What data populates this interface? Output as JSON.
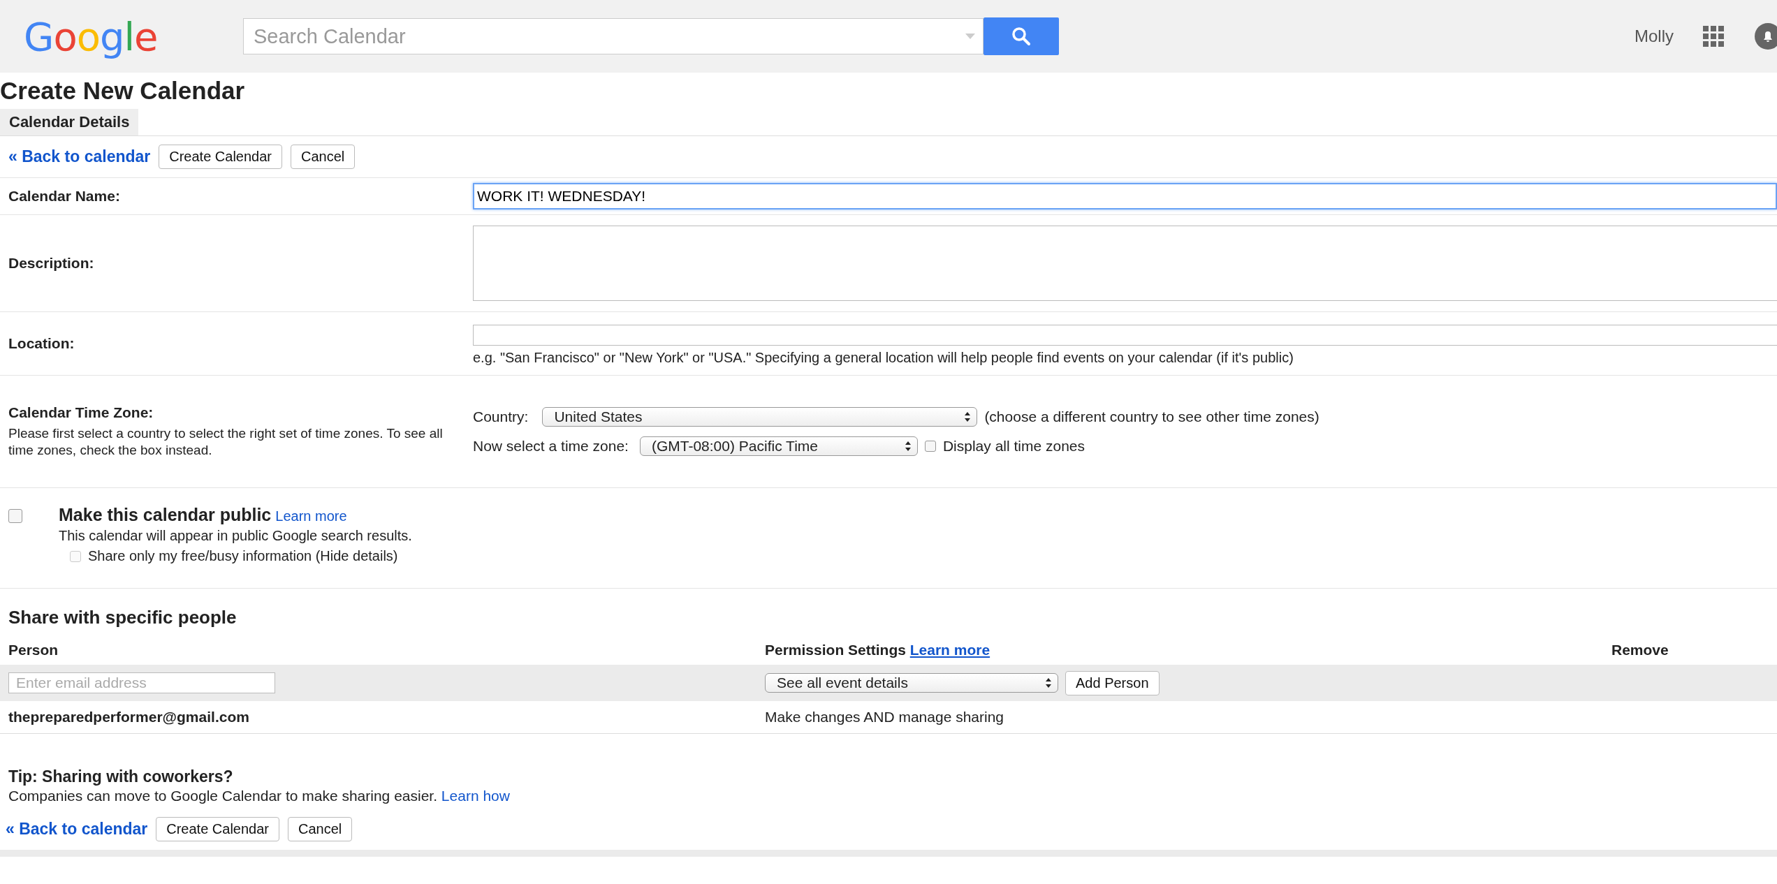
{
  "header": {
    "logo": "Google",
    "search": {
      "placeholder": "Search Calendar"
    },
    "user": "Molly"
  },
  "page_title": "Create New Calendar",
  "tabs": [
    {
      "label": "Calendar Details",
      "selected": true
    }
  ],
  "top_actions": {
    "back": "« Back to calendar",
    "buttons": [
      "Create Calendar",
      "Cancel"
    ]
  },
  "form": {
    "name": {
      "label": "Calendar Name:",
      "value": "WORK IT! WEDNESDAY!",
      "focused": true
    },
    "description": {
      "label": "Description:"
    },
    "location": {
      "label": "Location:",
      "hint": "e.g. \"San Francisco\" or \"New York\" or \"USA.\" Specifying a general location will help people find events on your calendar (if it's public)"
    },
    "time_zone": {
      "label": "Calendar Time Zone:",
      "help": "Please first select a country to select the right set of time zones. To see all time zones, check the box instead.",
      "country_label": "Country:",
      "country": "United States",
      "country_note": "(choose a different country to see other time zones)",
      "zone_label": "Now select a time zone:",
      "zone": "(GMT-08:00) Pacific Time",
      "display_all": {
        "label": "Display all time zones",
        "checked": false
      }
    },
    "public": {
      "label": "Make this calendar public",
      "checked": false,
      "link": "Learn more",
      "note": "This calendar will appear in public Google search results.",
      "free_busy": {
        "label": "Share only my free/busy information (Hide details)",
        "checked": false,
        "disabled": true
      }
    }
  },
  "sharing": {
    "title": "Share with specific people",
    "columns": [
      "Person",
      "Permission Settings",
      "Remove"
    ],
    "columns_link": "Learn more",
    "email": {
      "placeholder": "Enter email address"
    },
    "permission": "See all event details",
    "add_button": "Add Person",
    "rows": [
      {
        "person": "thepreparedperformer@gmail.com",
        "permission": "Make changes AND manage sharing"
      }
    ]
  },
  "tip": {
    "title": "Tip: Sharing with coworkers?",
    "text": "Companies can move to Google Calendar to make sharing easier.",
    "link": "Learn how"
  },
  "bottom_actions": {
    "back": "« Back to calendar",
    "buttons": [
      "Create Calendar",
      "Cancel"
    ]
  }
}
